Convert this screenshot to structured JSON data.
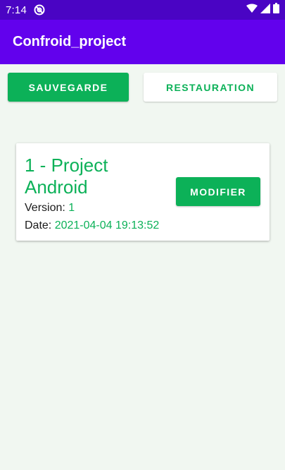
{
  "status_bar": {
    "time": "7:14",
    "app_icon": "at-sign-icon",
    "wifi_icon": "wifi-icon",
    "signal_icon": "signal-icon",
    "battery_icon": "battery-icon"
  },
  "app_bar": {
    "title": "Confroid_project"
  },
  "actions": {
    "save_label": "SAUVEGARDE",
    "restore_label": "RESTAURATION"
  },
  "projects": [
    {
      "title": "1 - Project Android",
      "version_label": "Version:",
      "version_value": "1",
      "date_label": "Date:",
      "date_value": "2021-04-04 19:13:52",
      "modify_label": "MODIFIER"
    }
  ],
  "colors": {
    "status_bar": "#4a04c4",
    "app_bar": "#6201ed",
    "accent_green": "#0cb158",
    "background": "#f1f7f1"
  }
}
